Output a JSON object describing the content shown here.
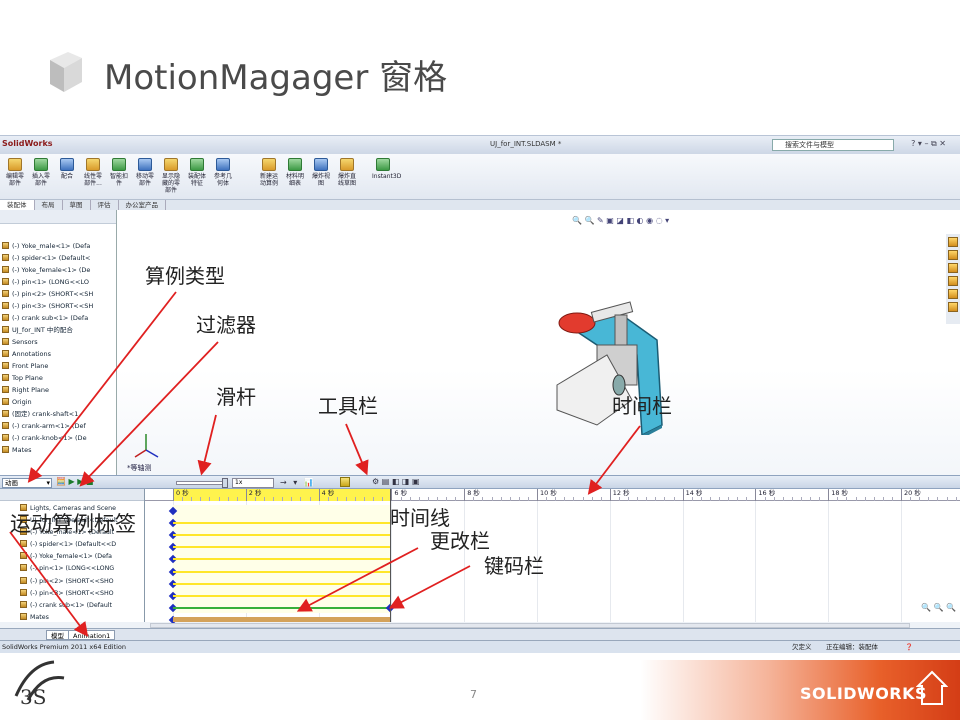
{
  "slide": {
    "title": "MotionMagager 窗格",
    "page_number": "7",
    "brand": "SOLIDWORKS"
  },
  "app": {
    "name": "SolidWorks",
    "document": "UJ_for_INT.SLDASM *",
    "search_placeholder": "搜索文件与模型",
    "status_left": "SolidWorks Premium 2011 x64 Edition",
    "status_undefined": "欠定义",
    "status_editing": "正在编辑：装配体"
  },
  "ribbon": {
    "buttons": [
      "编辑零部件",
      "插入零部件",
      "配合",
      "线性零部件...",
      "智能扣件",
      "移动零部件",
      "显示隐藏的零部件",
      "装配体特征",
      "参考几何体",
      "新建运动算例",
      "材料明细表",
      "爆炸视图",
      "爆炸直线草图",
      "Instant3D"
    ]
  },
  "command_tabs": [
    "装配体",
    "布局",
    "草图",
    "评估",
    "办公室产品"
  ],
  "feature_tree": {
    "items": [
      "(-) Yoke_male<1> (Defa",
      "(-) spider<1> (Default<",
      "(-) Yoke_female<1> (De",
      "(-) pin<1> (LONG<<LO",
      "(-) pin<2> (SHORT<<SH",
      "(-) pin<3> (SHORT<<SH",
      "(-) crank sub<1> (Defa",
      "UJ_for_INT 中的配合",
      "Sensors",
      "Annotations",
      "Front Plane",
      "Top Plane",
      "Right Plane",
      "Origin",
      "(固定) crank-shaft<1",
      "(-) crank-arm<1> (Def",
      "(-) crank-knob<1> (De",
      "Mates"
    ]
  },
  "view": {
    "orientation_label": "*等轴测"
  },
  "motion_manager": {
    "study_type": "动画",
    "tree_rows": [
      "Lights, Cameras and Scene",
      "UJ_for_INT (Default<Default",
      "(-) Yoke_male<1> (Default",
      "(-) spider<1> (Default<<D",
      "(-) Yoke_female<1> (Defa",
      "(-) pin<1> (LONG<<LONG",
      "(-) pin<2> (SHORT<<SHO",
      "(-) pin<3> (SHORT<<SHO",
      "(-) crank sub<1> (Default",
      "Mates"
    ],
    "ticks": [
      "0 秒",
      "2 秒",
      "4 秒",
      "6 秒",
      "8 秒",
      "10 秒",
      "12 秒",
      "14 秒",
      "16 秒",
      "18 秒",
      "20 秒"
    ],
    "tabs": [
      "模型",
      "Animation1"
    ]
  },
  "annotations": {
    "study_type": "算例类型",
    "filter": "过滤器",
    "slider": "滑杆",
    "toolbar": "工具栏",
    "time_bar": "时间栏",
    "timeline": "时间线",
    "change_bar": "更改栏",
    "key_bar": "键码栏",
    "study_tab": "运动算例标签"
  },
  "colors": {
    "timeline_yellow": "#fff34d",
    "key_diamond": "#1f2fbf",
    "change_bar_yellow": "#ffe628",
    "change_bar_green": "#38b03a",
    "arrow_red": "#e02020",
    "footer_orange": "#e8602a"
  }
}
